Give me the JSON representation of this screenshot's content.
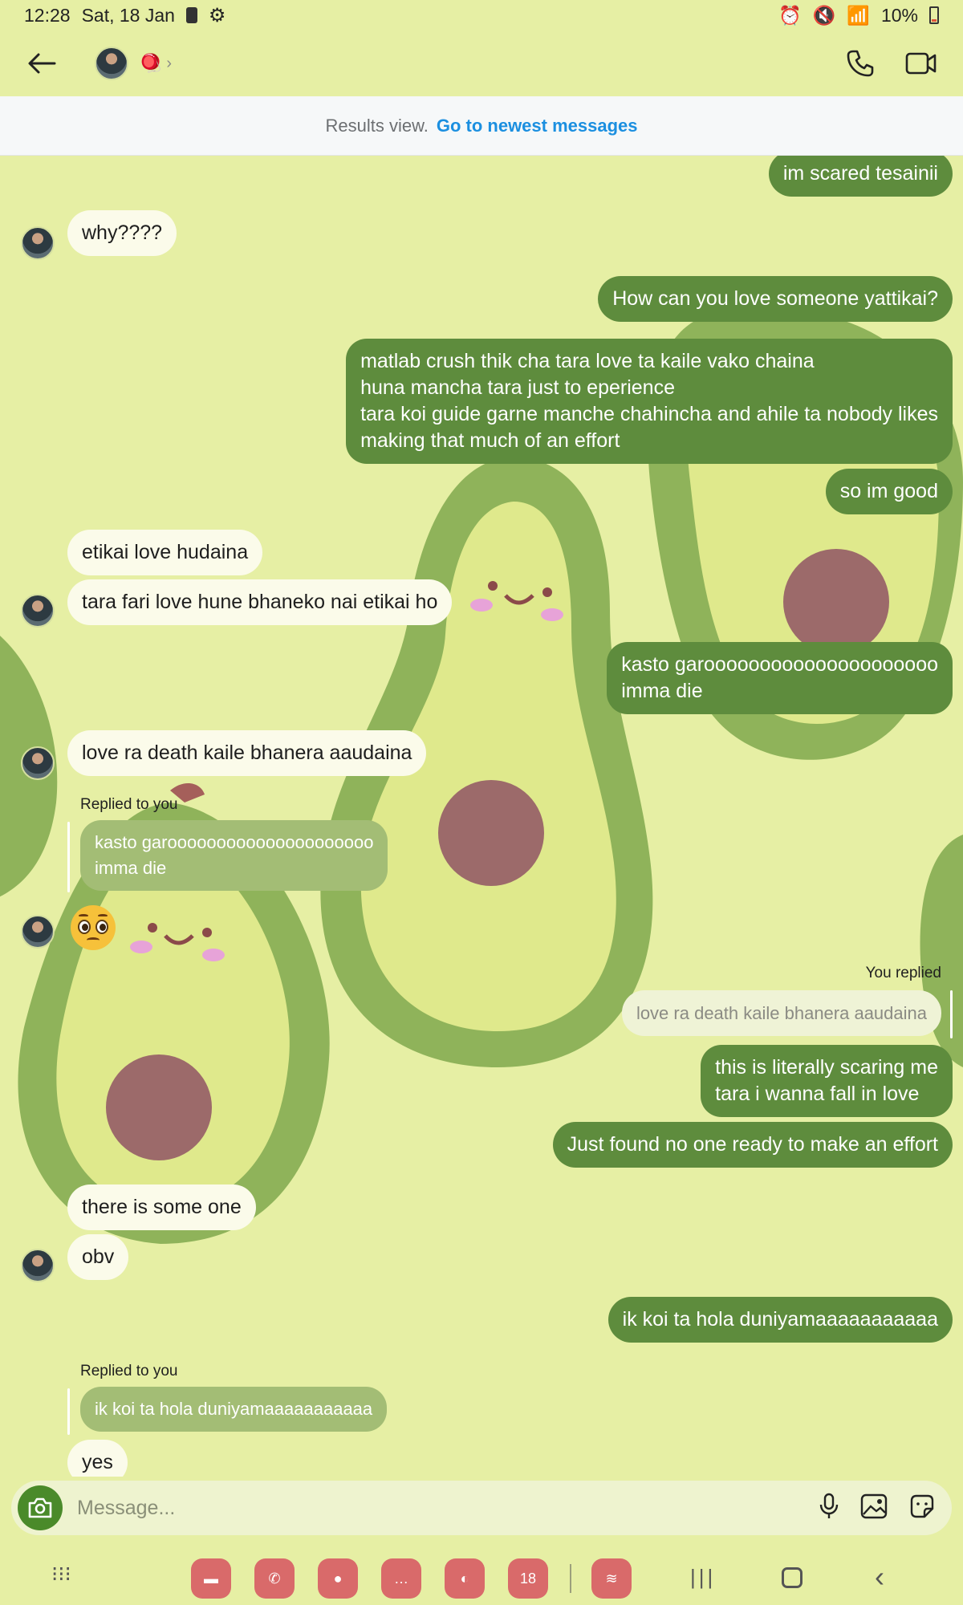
{
  "status_bar": {
    "time": "12:28",
    "date": "Sat, 18 Jan",
    "battery": "10%"
  },
  "header": {
    "contact_name": "🪀",
    "icons": [
      "back-arrow-icon",
      "phone-icon",
      "video-call-icon"
    ]
  },
  "banner": {
    "text": "Results view.",
    "link": "Go to newest messages"
  },
  "messages": [
    {
      "id": "m1",
      "side": "out",
      "lines": [
        "im scared tesainii"
      ]
    },
    {
      "id": "m2",
      "side": "in",
      "lines": [
        "why????"
      ]
    },
    {
      "id": "m3",
      "side": "out",
      "lines": [
        "How can you love someone yattikai?"
      ]
    },
    {
      "id": "m4",
      "side": "out",
      "lines": [
        "matlab crush thik cha tara love ta kaile vako chaina",
        "huna mancha tara just to eperience",
        "tara koi guide garne manche chahincha and ahile ta nobody likes",
        "making that much of an effort"
      ]
    },
    {
      "id": "m5",
      "side": "out",
      "lines": [
        "so im good"
      ]
    },
    {
      "id": "m6",
      "side": "in",
      "lines": [
        "etikai love hudaina"
      ]
    },
    {
      "id": "m7",
      "side": "in",
      "lines": [
        "tara fari love hune bhaneko nai etikai ho"
      ]
    },
    {
      "id": "m8",
      "side": "out",
      "lines": [
        "kasto garooooooooooooooooooooo",
        "imma die"
      ]
    },
    {
      "id": "m9",
      "side": "in",
      "lines": [
        "love ra death kaile bhanera aaudaina"
      ]
    },
    {
      "id": "m10",
      "side": "in",
      "reply_label": "Replied to you",
      "quote_lines": [
        "kasto garooooooooooooooooooooo",
        "imma die"
      ]
    },
    {
      "id": "m11",
      "side": "in",
      "emoji": "pleading-face-emoji"
    },
    {
      "id": "m12",
      "side": "out",
      "reply_label": "You replied",
      "quote_lines": [
        "love ra death kaile bhanera aaudaina"
      ]
    },
    {
      "id": "m13",
      "side": "out",
      "lines": [
        "this is literally scaring me",
        "tara i wanna fall in love"
      ]
    },
    {
      "id": "m14",
      "side": "out",
      "lines": [
        "Just found no one ready to make an effort"
      ]
    },
    {
      "id": "m15",
      "side": "in",
      "lines": [
        "there is some one"
      ]
    },
    {
      "id": "m16",
      "side": "in",
      "lines": [
        "obv"
      ]
    },
    {
      "id": "m17",
      "side": "out",
      "lines": [
        "ik koi ta hola duniyamaaaaaaaaaaa"
      ]
    },
    {
      "id": "m18",
      "side": "in",
      "reply_label": "Replied to you",
      "quote_lines": [
        "ik koi ta hola duniyamaaaaaaaaaaa"
      ]
    },
    {
      "id": "m19",
      "side": "in",
      "lines": [
        "yes"
      ]
    }
  ],
  "composer": {
    "placeholder": "Message...",
    "icons": [
      "camera-icon",
      "microphone-icon",
      "gallery-icon",
      "sticker-icon"
    ]
  },
  "navbar": {
    "dock_apps": [
      "files-app",
      "phone-app",
      "contacts-app",
      "messages-app",
      "internet-app",
      "calendar-app",
      "spotify-app"
    ],
    "calendar_day": "18",
    "nav_buttons": [
      "app-drawer-icon",
      "recents-icon",
      "home-icon",
      "back-icon"
    ]
  },
  "colors": {
    "background": "#e6efa4",
    "outgoing_bubble": "#5e8c3d",
    "incoming_bubble": "#fbfbea",
    "link": "#1b8fe0",
    "dock_app": "#d96a6a"
  }
}
